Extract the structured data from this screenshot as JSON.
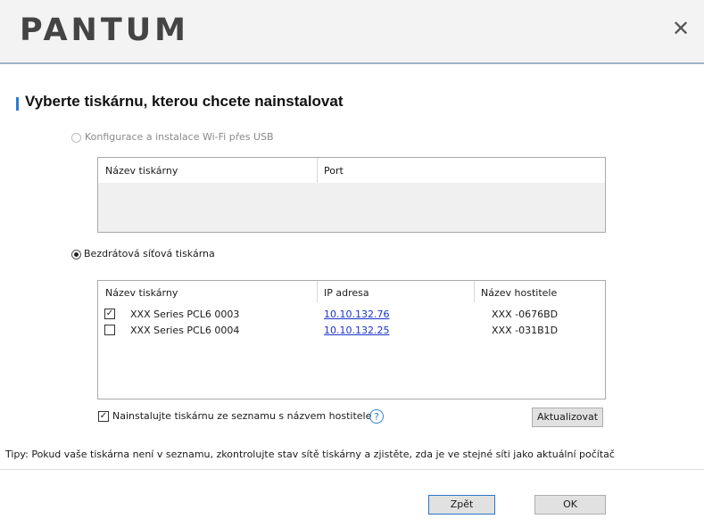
{
  "header": {
    "brand": "PANTUM",
    "close_icon": "close-icon"
  },
  "title": "Vyberte tiskárnu, kterou chcete nainstalovat",
  "wifi_option": {
    "label": "Konfigurace a instalace Wi-Fi přes USB",
    "selected": false,
    "enabled": false,
    "columns": [
      "Název tiskárny",
      "Port"
    ]
  },
  "network_option": {
    "label": "Bezdrátová síťová tiskárna",
    "selected": true,
    "columns": [
      "Název tiskárny",
      "IP adresa",
      "Název hostitele"
    ],
    "rows": [
      {
        "checked": true,
        "name": "XXX  Series PCL6 0003",
        "ip": "10.10.132.76",
        "host": "XXX -0676BD"
      },
      {
        "checked": false,
        "name": "XXX  Series PCL6 0004",
        "ip": "10.10.132.25",
        "host": "XXX -031B1D"
      }
    ]
  },
  "install_by_hostname": {
    "label": "Nainstalujte tiskárnu ze seznamu s názvem hostitele",
    "checked": true
  },
  "help_icon": "question-circle-icon",
  "refresh_label": "Aktualizovat",
  "tip": "Tipy: Pokud vaše tiskárna není v seznamu, zkontrolujte stav sítě tiskárny a zjistěte, zda je ve stejné síti jako aktuální počítač",
  "buttons": {
    "back": "Zpět",
    "ok": "OK"
  },
  "colors": {
    "accent": "#2d7cd6",
    "link": "#1a33cc",
    "header_bg": "#f3f3f3"
  }
}
